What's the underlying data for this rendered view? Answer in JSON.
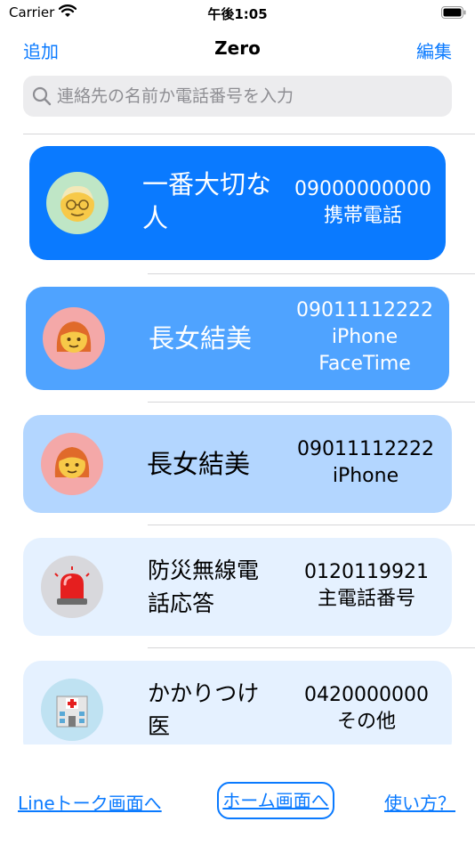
{
  "status_bar": {
    "carrier": "Carrier",
    "time": "午後1:05"
  },
  "nav": {
    "left": "追加",
    "title": "Zero",
    "right": "編集"
  },
  "search": {
    "placeholder": "連絡先の名前か電話番号を入力"
  },
  "contacts": [
    {
      "name": "一番大切な人",
      "number": "09000000000",
      "label": "携帯電話",
      "extra": "",
      "avatar": "older-person-icon",
      "card_color": "#0a7aff"
    },
    {
      "name": "長女結美",
      "number": "09011112222",
      "label": "iPhone",
      "extra": "FaceTime",
      "avatar": "woman-icon",
      "card_color": "#4fa3ff"
    },
    {
      "name": "長女結美",
      "number": "09011112222",
      "label": "iPhone",
      "extra": "",
      "avatar": "woman-icon",
      "card_color": "#b3d6ff"
    },
    {
      "name": "防災無線電話応答",
      "number": "0120119921",
      "label": "主電話番号",
      "extra": "",
      "avatar": "siren-icon",
      "card_color": "#e5f1ff"
    },
    {
      "name": "かかりつけ医",
      "number": "0420000000",
      "label": "その他",
      "extra": "",
      "avatar": "hospital-icon",
      "card_color": "#e5f1ff"
    }
  ],
  "bottom": {
    "line_link": "Lineトーク画面へ",
    "home_button": "ホーム画面へ",
    "help_link": "使い方？"
  },
  "colors": {
    "accent": "#0a7aff"
  }
}
